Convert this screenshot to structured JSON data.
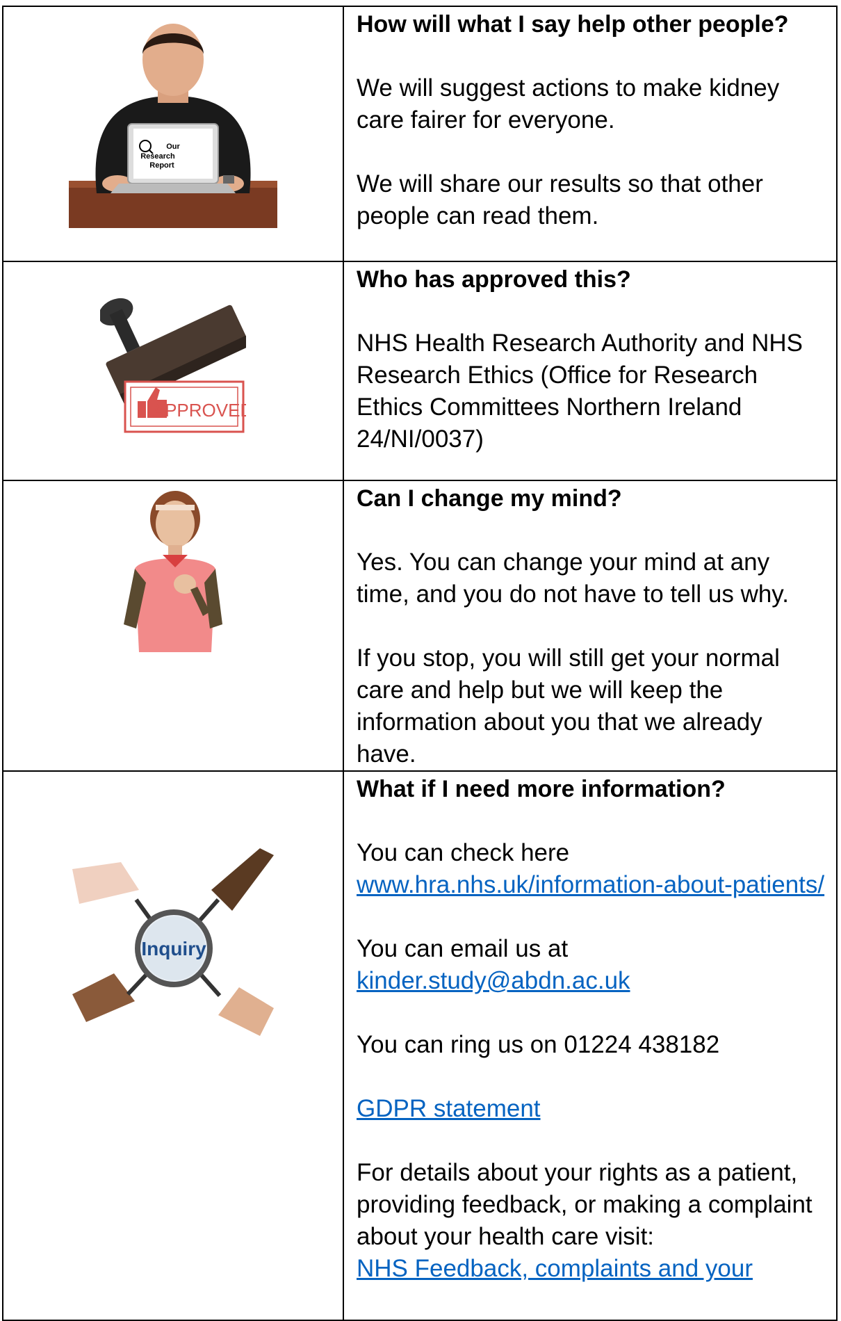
{
  "rows": [
    {
      "heading": "How will what I say help other people?",
      "p1": "We will suggest actions to make kidney care fairer for everyone.",
      "p2": "We will share our results so that other people can read them.",
      "image": {
        "icon": "man-with-laptop-icon",
        "screen_lines": [
          "Our",
          "Research",
          "Report"
        ]
      }
    },
    {
      "heading": "Who has approved this?",
      "p1": "NHS Health Research Authority and NHS Research Ethics (Office for Research Ethics Committees Northern Ireland 24/NI/0037)",
      "image": {
        "icon": "approved-stamp-icon",
        "stamp_text": "APPROVED"
      }
    },
    {
      "heading": "Can I change my mind?",
      "p1": "Yes. You can change your mind at any time, and you do not have to tell us why.",
      "p2": "If you stop, you will still get your normal care and help but we will keep the information about you that we already have.",
      "image": {
        "icon": "woman-hand-on-chest-icon"
      }
    },
    {
      "heading": "What if I need more information?",
      "check_text": "You can check here",
      "hra_link": "www.hra.nhs.uk/information-about-patients/",
      "email_text": "You can email us at",
      "email_link": "kinder.study@abdn.ac.uk",
      "phone_text": "You can ring us on 01224 438182",
      "gdpr_link": "GDPR statement",
      "rights_text": "For details about your rights as a patient, providing feedback, or making a complaint about your health care visit:",
      "nhs_link": "NHS Feedback, complaints and your",
      "image": {
        "icon": "inquiry-magnifier-icon",
        "lens_text": "Inquiry"
      }
    }
  ],
  "colors": {
    "link": "#0563c1",
    "border": "#000000",
    "stamp_red": "#d9534f"
  }
}
